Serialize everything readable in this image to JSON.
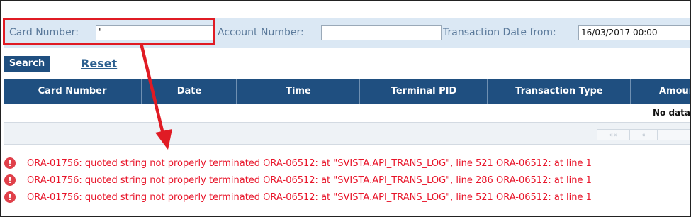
{
  "filters": {
    "card_number_label": "Card Number:",
    "card_number_value": "'",
    "account_number_label": "Account Number:",
    "account_number_value": "",
    "date_from_label": "Transaction Date from:",
    "date_from_value": "16/03/2017 00:00"
  },
  "actions": {
    "search_label": "Search",
    "reset_label": "Reset"
  },
  "table": {
    "columns": [
      "Card Number",
      "Date",
      "Time",
      "Terminal PID",
      "Transaction Type",
      "Amour"
    ],
    "empty_text": "No data"
  },
  "pager": {
    "first": "««",
    "prev": "«",
    "page": ""
  },
  "errors": [
    "ORA-01756: quoted string not properly terminated ORA-06512: at \"SVISTA.API_TRANS_LOG\", line 521 ORA-06512: at line 1",
    "ORA-01756: quoted string not properly terminated ORA-06512: at \"SVISTA.API_TRANS_LOG\", line 286 ORA-06512: at line 1",
    "ORA-01756: quoted string not properly terminated ORA-06512: at \"SVISTA.API_TRANS_LOG\", line 521 ORA-06512: at line 1"
  ],
  "colors": {
    "header_bg": "#1f4f80",
    "filter_bg": "#dbe8f4",
    "error_text": "#e8152a",
    "highlight": "#e01b24"
  },
  "icons": {
    "error": "exclamation-circle-icon",
    "annotation": "red-arrow-icon"
  }
}
